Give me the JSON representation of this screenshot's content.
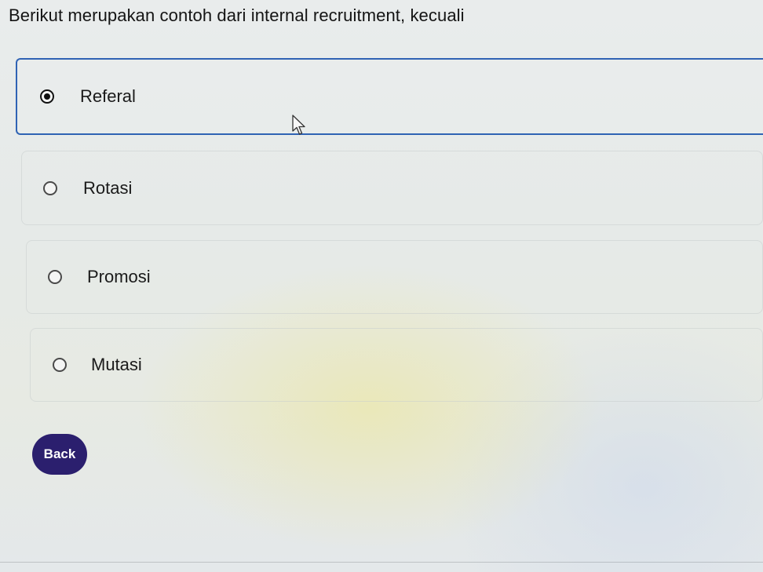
{
  "question": {
    "text": "Berikut merupakan contoh dari internal recruitment, kecuali"
  },
  "options": [
    {
      "label": "Referal",
      "selected": true
    },
    {
      "label": "Rotasi",
      "selected": false
    },
    {
      "label": "Promosi",
      "selected": false
    },
    {
      "label": "Mutasi",
      "selected": false
    }
  ],
  "navigation": {
    "back_label": "Back"
  },
  "colors": {
    "selected_border": "#2f63b4",
    "back_button_bg": "#2b1f6e",
    "back_button_text": "#ffffff"
  },
  "icons": {
    "cursor": "mouse-pointer-icon",
    "radio_checked": "radio-checked-icon",
    "radio_unchecked": "radio-unchecked-icon"
  }
}
